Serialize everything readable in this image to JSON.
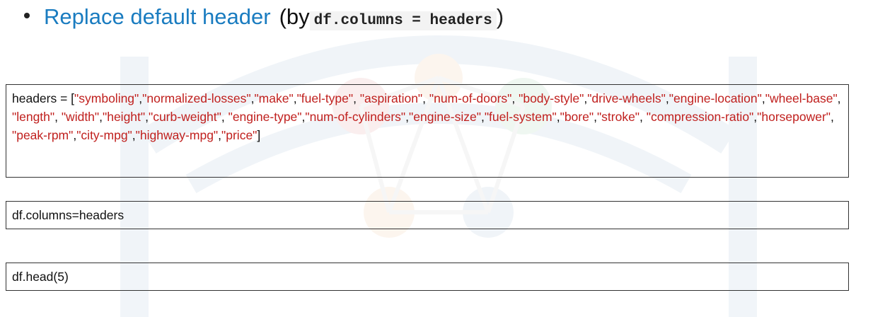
{
  "bullet": {
    "title": "Replace default header",
    "paren_open": "(by ",
    "code": "df.columns = headers",
    "paren_close": ")"
  },
  "headers_box": {
    "prefix": "headers = [",
    "items": [
      "\"symboling\"",
      "\"normalized-losses\"",
      "\"make\"",
      "\"fuel-type\"",
      "\"aspiration\"",
      "\"num-of-doors\"",
      "\"body-style\"",
      "\"drive-wheels\"",
      "\"engine-location\"",
      "\"wheel-base\"",
      "\"length\"",
      "\"width\"",
      "\"height\"",
      "\"curb-weight\"",
      "\"engine-type\"",
      "\"num-of-cylinders\"",
      "\"engine-size\"",
      "\"fuel-system\"",
      "\"bore\"",
      "\"stroke\"",
      "\"compression-ratio\"",
      "\"horsepower\"",
      "\"peak-rpm\"",
      "\"city-mpg\"",
      "\"highway-mpg\"",
      "\"price\""
    ],
    "suffix": "]"
  },
  "columns_box": {
    "code": "df.columns=headers"
  },
  "head_box": {
    "code": "df.head(5)"
  },
  "colors": {
    "title_blue": "#1a7cc0",
    "string_red": "#c0201e",
    "text": "#111111"
  }
}
